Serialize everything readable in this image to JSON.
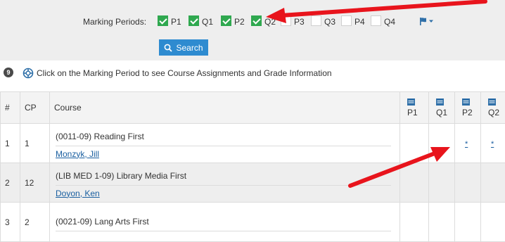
{
  "marking_periods": {
    "label": "Marking Periods:",
    "options": [
      {
        "label": "P1",
        "checked": true
      },
      {
        "label": "Q1",
        "checked": true
      },
      {
        "label": "P2",
        "checked": true
      },
      {
        "label": "Q2",
        "checked": true
      },
      {
        "label": "P3",
        "checked": false
      },
      {
        "label": "Q3",
        "checked": false
      },
      {
        "label": "P4",
        "checked": false
      },
      {
        "label": "Q4",
        "checked": false
      }
    ]
  },
  "search_button": {
    "label": "Search"
  },
  "info": {
    "count": "9",
    "text": "Click on the Marking Period to see Course Assignments and Grade Information"
  },
  "table": {
    "headers": {
      "num": "#",
      "cp": "CP",
      "course": "Course",
      "p1": "P1",
      "q1": "Q1",
      "p2": "P2",
      "q2": "Q2"
    },
    "rows": [
      {
        "num": "1",
        "cp": "1",
        "course": "(0011-09) Reading First",
        "teacher": "Monzyk, Jill",
        "p2": "*",
        "q2": "*"
      },
      {
        "num": "2",
        "cp": "12",
        "course": "(LIB MED 1-09) Library Media First",
        "teacher": "Doyon, Ken",
        "p2": "",
        "q2": ""
      },
      {
        "num": "3",
        "cp": "2",
        "course": "(0021-09) Lang Arts First",
        "teacher": "",
        "p2": "",
        "q2": ""
      }
    ]
  },
  "colors": {
    "accent": "#2e8bd0",
    "checkbox": "#2fa84f",
    "arrow": "#e8141c",
    "link": "#1a5fa0"
  }
}
